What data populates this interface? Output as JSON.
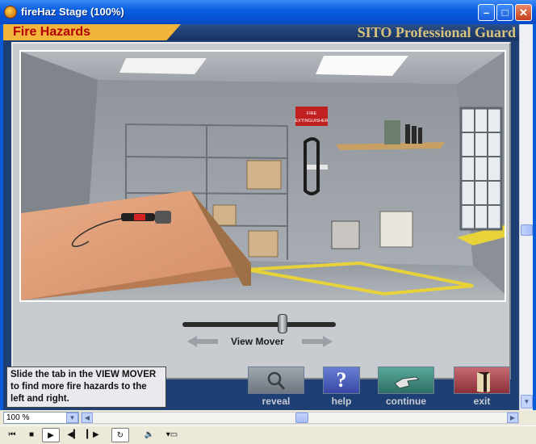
{
  "window": {
    "title": "fireHaz Stage (100%)",
    "min": "–",
    "max": "□",
    "close": "✕"
  },
  "header": {
    "section_title": "Fire Hazards",
    "brand": "SITO Professional Guard"
  },
  "scene": {
    "sign_line1": "FIRE",
    "sign_line2": "EXTINGUISHER"
  },
  "view_mover": {
    "label": "View Mover",
    "position": 0.65
  },
  "instructions": "Slide the tab in the VIEW MOVER to find more fire hazards to the left and right.",
  "controls": {
    "reveal": "reveal",
    "help": "help",
    "continue": "continue",
    "exit": "exit",
    "help_glyph": "?"
  },
  "statusbar": {
    "zoom": "100 %"
  },
  "icons": {
    "reveal": "magnifier-icon",
    "help": "question-icon",
    "continue": "pointing-hand-icon",
    "exit": "door-icon"
  }
}
